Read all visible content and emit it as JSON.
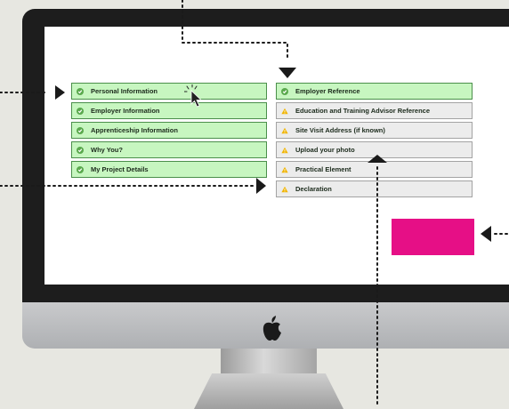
{
  "checklist": {
    "left": [
      {
        "label": "Personal Information",
        "status": "complete"
      },
      {
        "label": "Employer Information",
        "status": "complete"
      },
      {
        "label": "Apprenticeship Information",
        "status": "complete"
      },
      {
        "label": "Why You?",
        "status": "complete"
      },
      {
        "label": "My Project Details",
        "status": "complete"
      }
    ],
    "right": [
      {
        "label": "Employer Reference",
        "status": "complete"
      },
      {
        "label": "Education and Training Advisor Reference",
        "status": "incomplete"
      },
      {
        "label": "Site Visit Address (if known)",
        "status": "incomplete"
      },
      {
        "label": "Upload your photo",
        "status": "incomplete"
      },
      {
        "label": "Practical Element",
        "status": "incomplete"
      },
      {
        "label": "Declaration",
        "status": "incomplete"
      }
    ]
  },
  "icons": {
    "complete": "check-circle-icon",
    "incomplete": "warning-triangle-icon",
    "pointer": "mouse-pointer-icon",
    "logo": "apple-logo-icon"
  },
  "colors": {
    "complete_bg": "#c7f6c0",
    "complete_border": "#4b8f4b",
    "incomplete_bg": "#ececec",
    "warning": "#f0b400",
    "highlight_block": "#e60f86",
    "background": "#e7e7e1"
  }
}
